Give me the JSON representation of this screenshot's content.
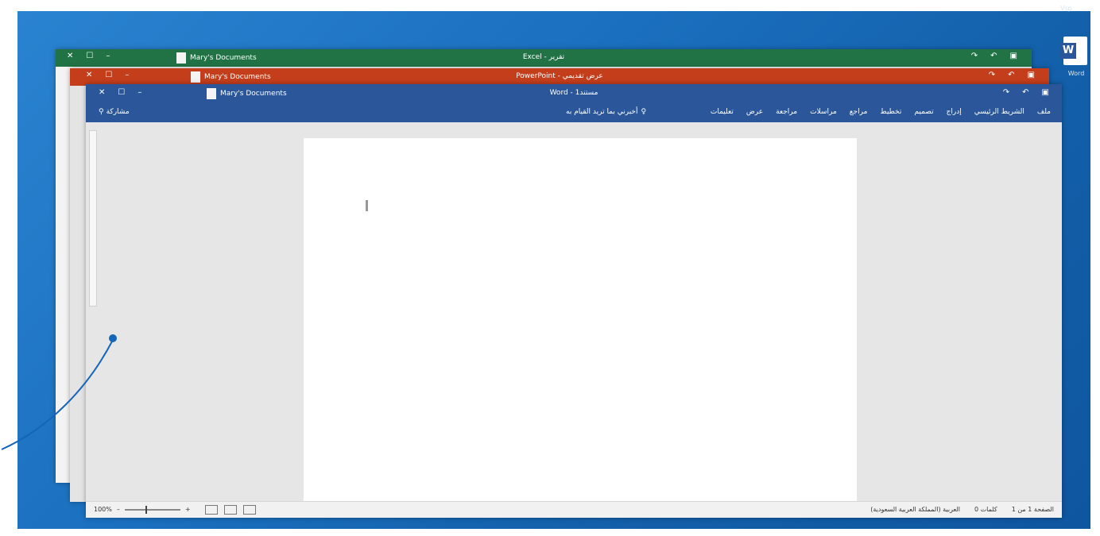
{
  "desktop": {
    "shortcut_letter": "W",
    "shortcut_label": "Word",
    "clock": "Vsp"
  },
  "windows": {
    "excel": {
      "file": "Mary's Documents",
      "title": "Excel - تقرير"
    },
    "powerpoint": {
      "file": "Mary's Documents",
      "title": "PowerPoint - عرض تقديمي"
    },
    "word": {
      "file": "Mary's Documents",
      "title": "Word - مستند1",
      "tabs": [
        "ملف",
        "الشريط الرئيسي",
        "إدراج",
        "تصميم",
        "تخطيط",
        "مراجع",
        "مراسلات",
        "مراجعة",
        "عرض",
        "تعليمات"
      ],
      "tell_me": "أخبرني بما تريد القيام به",
      "share": "مشاركة",
      "status_items": [
        "الصفحة 1 من 1",
        "0 كلمات",
        "العربية (المملكة العربية السعودية)"
      ],
      "zoom": "100%"
    }
  },
  "colors": {
    "excel": "#217346",
    "powerpoint": "#c43e1c",
    "word": "#2b579a",
    "desktop": "#1a6fbe",
    "callout": "#1565b8"
  },
  "icons": {
    "word_shortcut": "word-app-icon",
    "tell_me": "lightbulb-icon",
    "share": "person-icon",
    "save": "save-icon",
    "undo": "undo-icon",
    "redo": "redo-icon",
    "close": "close-icon",
    "maximize": "maximize-icon",
    "minimize": "minimize-icon"
  }
}
